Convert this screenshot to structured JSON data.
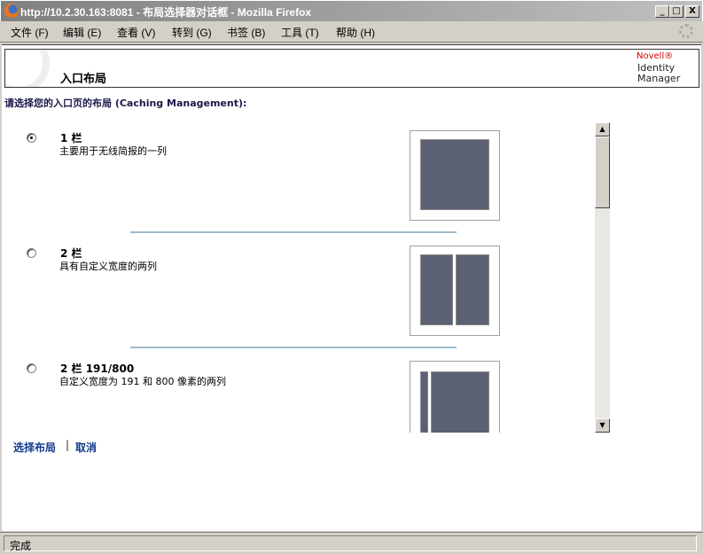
{
  "window": {
    "title": "http://10.2.30.163:8081 - 布局选择器对话框 - Mozilla Firefox",
    "minimize": "_",
    "maximize": "□",
    "close": "X"
  },
  "menu": [
    "文件 (F)",
    "编辑 (E)",
    "查看 (V)",
    "转到 (G)",
    "书签 (B)",
    "工具 (T)",
    "帮助 (H)"
  ],
  "header": {
    "title": "入口布局",
    "brand": "Novell®",
    "product_line1": "Identity",
    "product_line2": "Manager"
  },
  "prompt": "请选择您的入口页的布局 (Caching Management):",
  "options": [
    {
      "title": "1 栏",
      "desc": "主要用于无线简报的一列",
      "selected": true
    },
    {
      "title": "2 栏",
      "desc": "具有自定义宽度的两列",
      "selected": false
    },
    {
      "title": "2 栏 191/800",
      "desc": "自定义宽度为 191 和 800 像素的两列",
      "selected": false
    }
  ],
  "actions": {
    "select": "选择布局",
    "separator": "|",
    "cancel": "取消"
  },
  "status": "完成",
  "colors": {
    "layout_block": "#5c6073",
    "separator": "#9dbbcc",
    "link": "#123a8c"
  }
}
